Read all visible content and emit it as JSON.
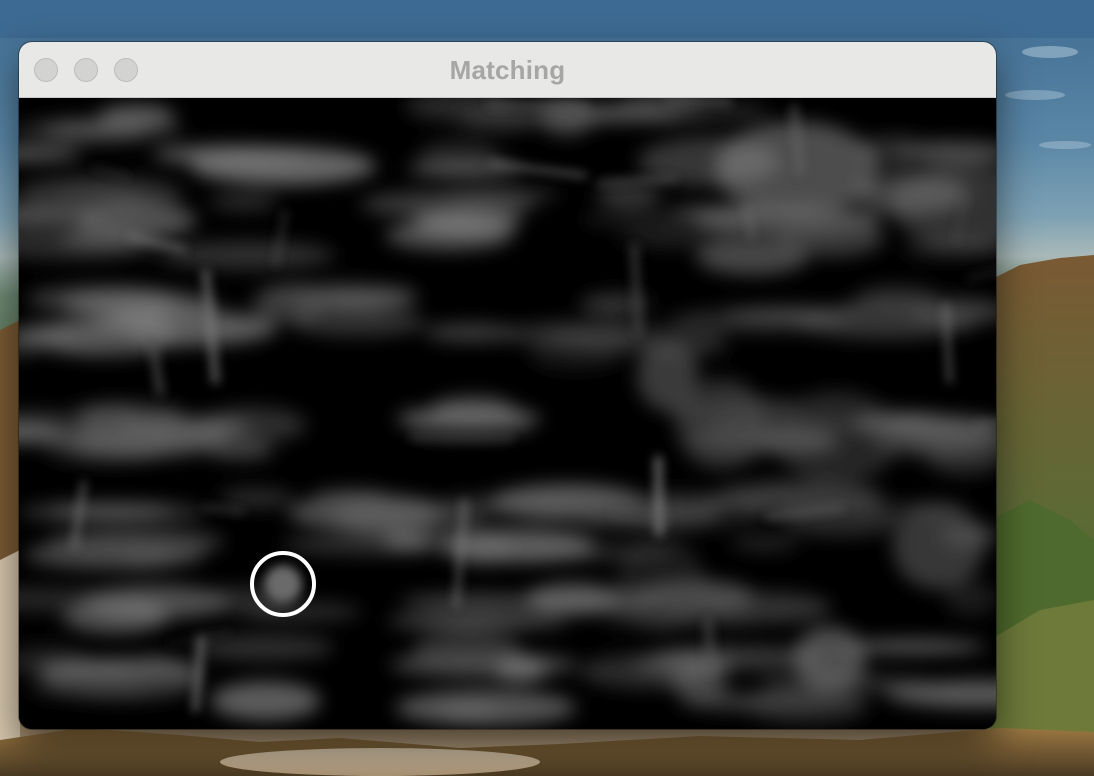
{
  "window": {
    "title": "Matching",
    "controls": [
      {
        "name": "close",
        "icon": "traffic-light-close-icon",
        "color": "#d3d3d1"
      },
      {
        "name": "minimize",
        "icon": "traffic-light-minimize-icon",
        "color": "#d3d3d1"
      },
      {
        "name": "zoom",
        "icon": "traffic-light-zoom-icon",
        "color": "#d3d3d1"
      }
    ]
  },
  "image_view": {
    "description_icon": "template-matching-result-map",
    "marker": {
      "icon": "match-location-circle-icon",
      "color": "#ffffff"
    },
    "colors": {
      "background": "#000000",
      "blobs": "#9a9a9a"
    }
  },
  "desktop": {
    "wallpaper_icon": "mountain-landscape-wallpaper",
    "colors": {
      "sky": "#3f6c92",
      "hills": "#5b6e3e",
      "ridge": "#8a6b3c"
    }
  }
}
